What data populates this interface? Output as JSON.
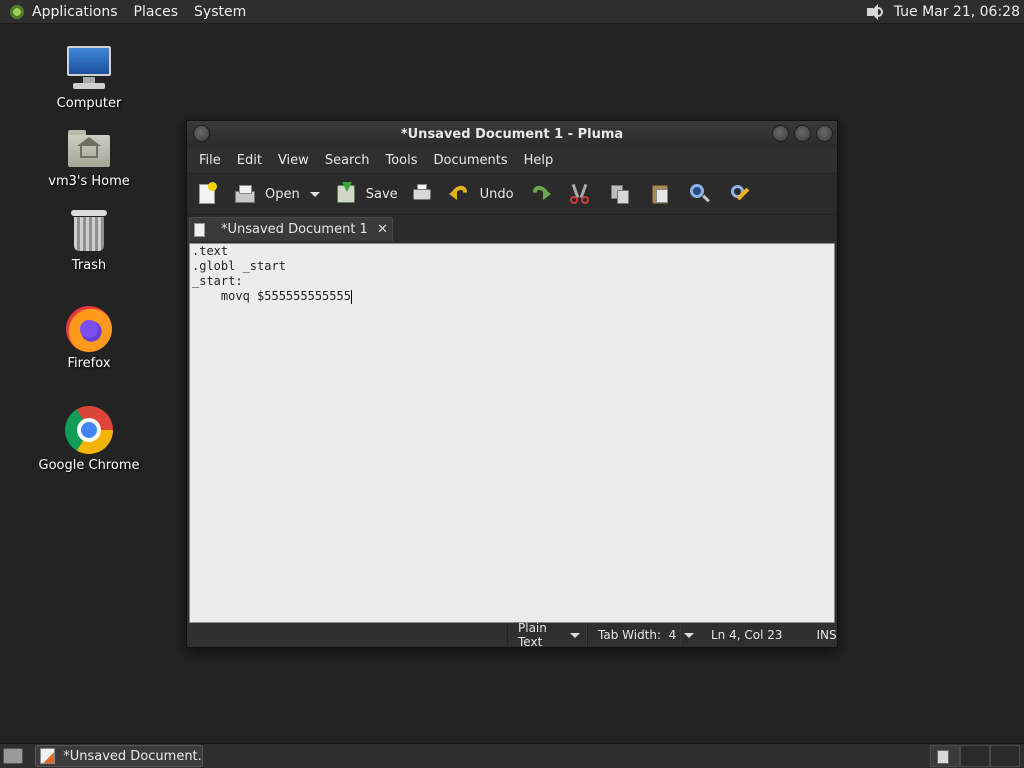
{
  "top_panel": {
    "menus": [
      "Applications",
      "Places",
      "System"
    ],
    "clock": "Tue Mar 21, 06:28"
  },
  "desktop_icons": [
    {
      "label": "Computer",
      "icon": "computer-icon"
    },
    {
      "label": "vm3's Home",
      "icon": "home-folder-icon"
    },
    {
      "label": "Trash",
      "icon": "trash-icon"
    },
    {
      "label": "Firefox",
      "icon": "firefox-icon"
    },
    {
      "label": "Google Chrome",
      "icon": "chrome-icon"
    }
  ],
  "window": {
    "title": "*Unsaved Document 1 - Pluma",
    "menu": [
      "File",
      "Edit",
      "View",
      "Search",
      "Tools",
      "Documents",
      "Help"
    ],
    "toolbar": {
      "open_label": "Open",
      "save_label": "Save",
      "undo_label": "Undo"
    },
    "tab": {
      "label": "*Unsaved Document 1",
      "close": "✕"
    },
    "editor_lines": [
      ".text",
      ".globl _start",
      "_start:",
      "    movq $555555555555"
    ],
    "status": {
      "language": "Plain Text",
      "tab_width": "Tab Width:  4",
      "position": "Ln 4, Col 23",
      "mode": "INS"
    }
  },
  "bottom_panel": {
    "task_label": "*Unsaved Document..."
  }
}
